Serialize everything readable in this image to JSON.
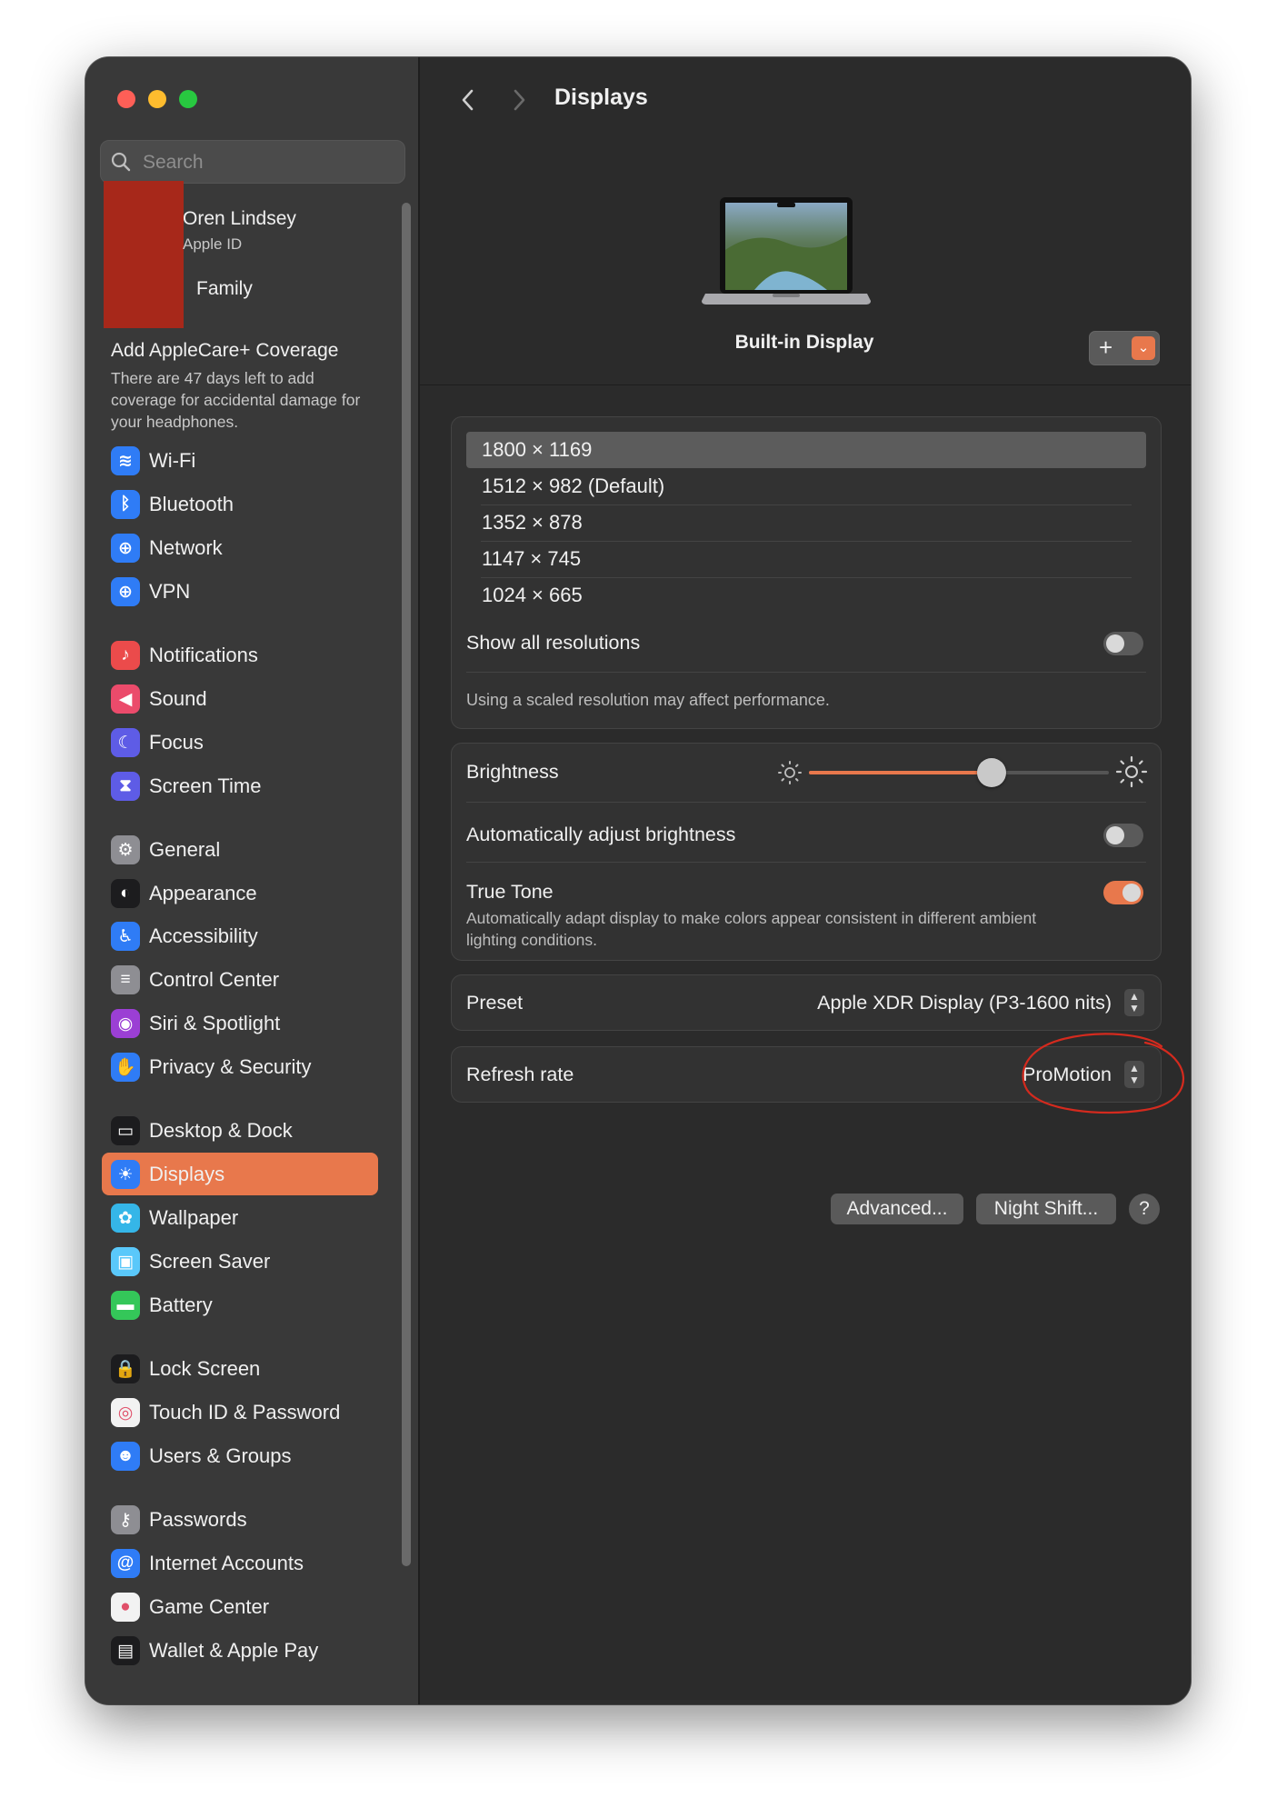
{
  "sidebar": {
    "search_placeholder": "Search",
    "account": {
      "name": "Oren Lindsey",
      "subtitle": "Apple ID",
      "family": "Family"
    },
    "applecare": {
      "title": "Add AppleCare+ Coverage",
      "body": "There are 47 days left to add coverage for accidental damage for your headphones."
    },
    "items": [
      {
        "label": "Wi-Fi",
        "icon": "wifi-icon",
        "color": "#2f7cf6"
      },
      {
        "label": "Bluetooth",
        "icon": "bluetooth-icon",
        "color": "#2f7cf6"
      },
      {
        "label": "Network",
        "icon": "globe-icon",
        "color": "#2f7cf6"
      },
      {
        "label": "VPN",
        "icon": "vpn-globe-icon",
        "color": "#2f7cf6"
      },
      {
        "label": "Notifications",
        "icon": "bell-icon",
        "color": "#eb4b4b"
      },
      {
        "label": "Sound",
        "icon": "speaker-icon",
        "color": "#eb4b6b"
      },
      {
        "label": "Focus",
        "icon": "moon-icon",
        "color": "#5e5ce6"
      },
      {
        "label": "Screen Time",
        "icon": "hourglass-icon",
        "color": "#5e5ce6"
      },
      {
        "label": "General",
        "icon": "gear-icon",
        "color": "#8e8e93"
      },
      {
        "label": "Appearance",
        "icon": "appearance-icon",
        "color": "#1c1c1e"
      },
      {
        "label": "Accessibility",
        "icon": "accessibility-icon",
        "color": "#2f7cf6"
      },
      {
        "label": "Control Center",
        "icon": "control-center-icon",
        "color": "#8e8e93"
      },
      {
        "label": "Siri & Spotlight",
        "icon": "siri-icon",
        "color": "#9b3fd4"
      },
      {
        "label": "Privacy & Security",
        "icon": "hand-icon",
        "color": "#2f7cf6"
      },
      {
        "label": "Desktop & Dock",
        "icon": "dock-icon",
        "color": "#1c1c1e"
      },
      {
        "label": "Displays",
        "icon": "sun-icon",
        "color": "#2f7cf6"
      },
      {
        "label": "Wallpaper",
        "icon": "flower-icon",
        "color": "#35b6e8"
      },
      {
        "label": "Screen Saver",
        "icon": "screen-saver-icon",
        "color": "#5ac8fa"
      },
      {
        "label": "Battery",
        "icon": "battery-icon",
        "color": "#34c759"
      },
      {
        "label": "Lock Screen",
        "icon": "lock-icon",
        "color": "#1c1c1e"
      },
      {
        "label": "Touch ID & Password",
        "icon": "fingerprint-icon",
        "color": "#f2f2f2"
      },
      {
        "label": "Users & Groups",
        "icon": "users-icon",
        "color": "#2f7cf6"
      },
      {
        "label": "Passwords",
        "icon": "key-icon",
        "color": "#8e8e93"
      },
      {
        "label": "Internet Accounts",
        "icon": "at-icon",
        "color": "#2f7cf6"
      },
      {
        "label": "Game Center",
        "icon": "game-center-icon",
        "color": "#f2f2f2"
      },
      {
        "label": "Wallet & Apple Pay",
        "icon": "wallet-icon",
        "color": "#1c1c1e"
      }
    ],
    "selected": "Displays"
  },
  "header": {
    "title": "Displays",
    "display_name": "Built-in Display"
  },
  "resolutions": {
    "options": [
      "1800 × 1169",
      "1512 × 982 (Default)",
      "1352 × 878",
      "1147 × 745",
      "1024 × 665"
    ],
    "selected_index": 0,
    "show_all_label": "Show all resolutions",
    "show_all_on": false,
    "note": "Using a scaled resolution may affect performance."
  },
  "brightness": {
    "label": "Brightness",
    "level": 0.61,
    "auto_label": "Automatically adjust brightness",
    "auto_on": false,
    "true_tone_label": "True Tone",
    "true_tone_desc": "Automatically adapt display to make colors appear consistent in different ambient lighting conditions.",
    "true_tone_on": true
  },
  "preset": {
    "label": "Preset",
    "value": "Apple XDR Display (P3-1600 nits)"
  },
  "refresh": {
    "label": "Refresh rate",
    "value": "ProMotion"
  },
  "buttons": {
    "advanced": "Advanced...",
    "night_shift": "Night Shift...",
    "help": "?"
  },
  "colors": {
    "accent": "#e8784c",
    "annotation": "#d42a1e"
  }
}
